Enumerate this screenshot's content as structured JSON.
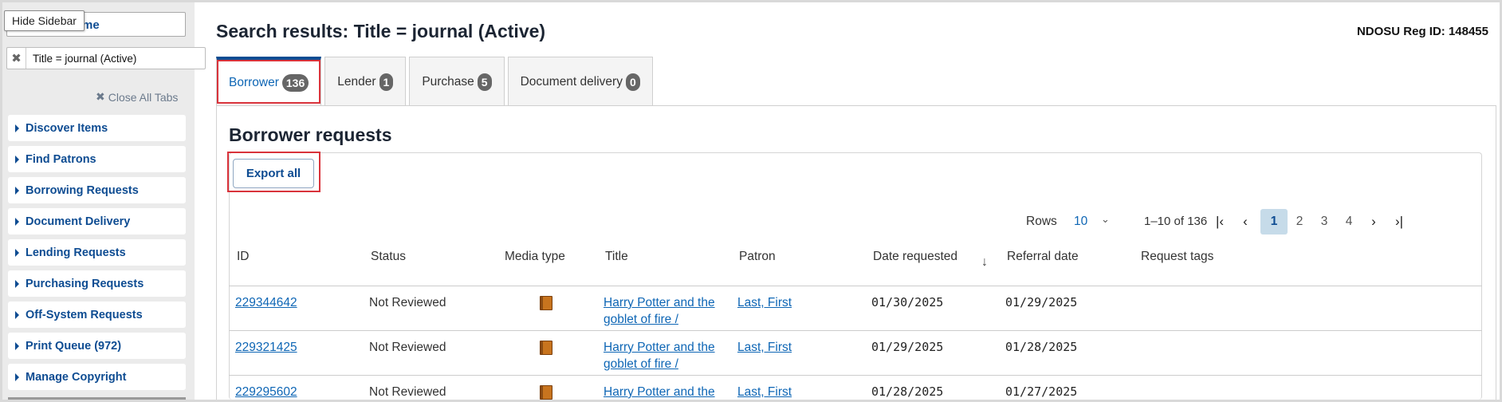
{
  "sidebar": {
    "tooltip": "Hide Sidebar",
    "home_text": "me",
    "search_tab_label": "Title = journal (Active)",
    "close_all": "Close All Tabs",
    "items": [
      {
        "label": "Discover Items"
      },
      {
        "label": "Find Patrons"
      },
      {
        "label": "Borrowing Requests"
      },
      {
        "label": "Document Delivery"
      },
      {
        "label": "Lending Requests"
      },
      {
        "label": "Purchasing Requests"
      },
      {
        "label": "Off-System Requests"
      },
      {
        "label": "Print Queue (972)"
      },
      {
        "label": "Manage Copyright"
      }
    ]
  },
  "header": {
    "title": "Search results: Title = journal (Active)",
    "reg_id": "NDOSU Reg ID: 148455"
  },
  "tabs": [
    {
      "label": "Borrower",
      "count": "136",
      "active": true
    },
    {
      "label": "Lender",
      "count": "1"
    },
    {
      "label": "Purchase",
      "count": "5"
    },
    {
      "label": "Document delivery",
      "count": "0"
    }
  ],
  "section": {
    "title": "Borrower requests",
    "export_label": "Export all"
  },
  "pager": {
    "rows_label": "Rows",
    "rows_value": "10",
    "range": "1–10 of 136",
    "pages": [
      "1",
      "2",
      "3",
      "4"
    ],
    "current_page": "1"
  },
  "table": {
    "columns": [
      "ID",
      "Status",
      "Media type",
      "Title",
      "Patron",
      "Date requested",
      "Referral date",
      "Request tags"
    ],
    "rows": [
      {
        "id": "229344642",
        "status": "Not Reviewed",
        "title_line1": "Harry Potter and the",
        "title_line2": "goblet of fire /",
        "patron": "Last, First",
        "date_requested": "01/30/2025",
        "referral_date": "01/29/2025"
      },
      {
        "id": "229321425",
        "status": "Not Reviewed",
        "title_line1": "Harry Potter and the",
        "title_line2": "goblet of fire /",
        "patron": "Last, First",
        "date_requested": "01/29/2025",
        "referral_date": "01/28/2025"
      },
      {
        "id": "229295602",
        "status": "Not Reviewed",
        "title_line1": "Harry Potter and the",
        "title_line2": "",
        "patron": "Last, First",
        "date_requested": "01/28/2025",
        "referral_date": "01/27/2025"
      }
    ]
  },
  "colors": {
    "brand_blue": "#0e4c92",
    "link_blue": "#0e66b5",
    "highlight_red": "#d9333b",
    "badge_gray": "#666666",
    "current_page_bg": "#c6dbe9"
  }
}
